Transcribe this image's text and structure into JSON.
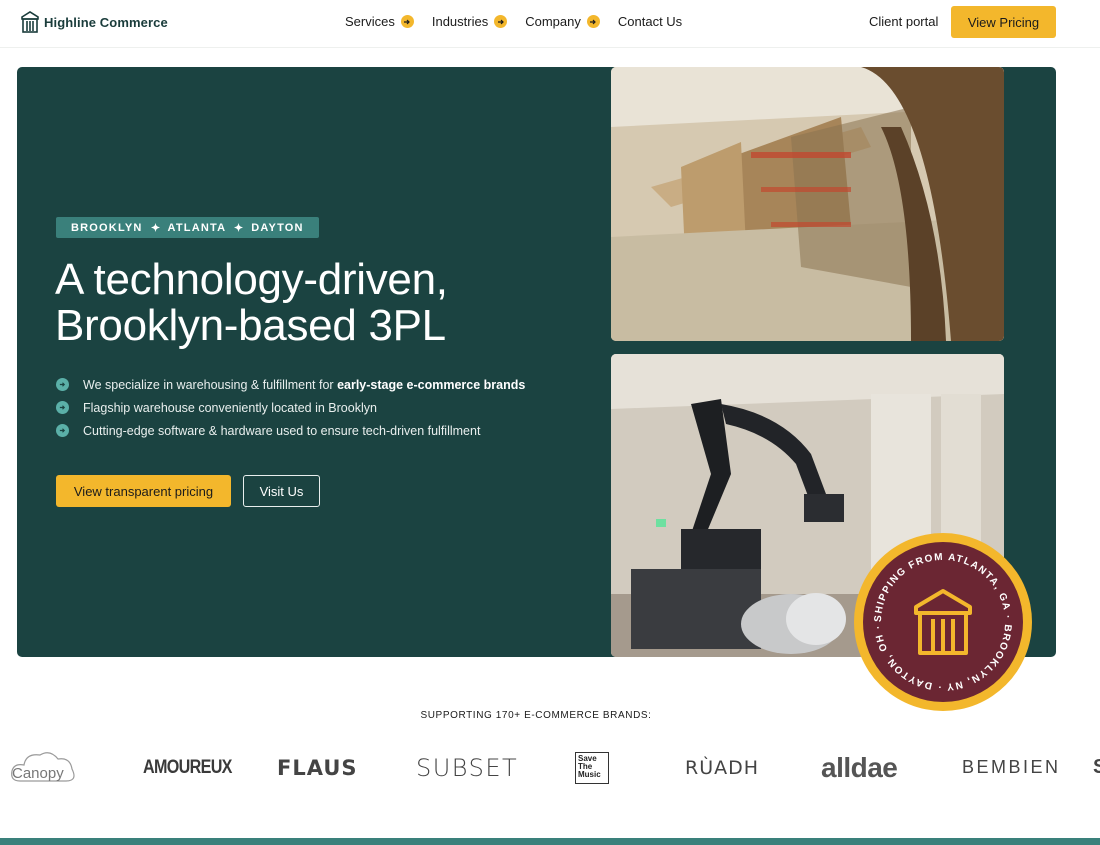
{
  "nav": {
    "logo_text": "Highline Commerce",
    "menu": [
      {
        "label": "Services",
        "has_arrow": true
      },
      {
        "label": "Industries",
        "has_arrow": true
      },
      {
        "label": "Company",
        "has_arrow": true
      },
      {
        "label": "Contact Us",
        "has_arrow": false
      }
    ],
    "client_portal": "Client portal",
    "cta": "View Pricing"
  },
  "hero": {
    "locations": [
      "BROOKLYN",
      "ATLANTA",
      "DAYTON"
    ],
    "headline_line1": "A technology-driven,",
    "headline_line2": "Brooklyn-based 3PL",
    "bullets": [
      {
        "text": "We specialize in warehousing & fulfillment for ",
        "bold": "early-stage e-commerce brands"
      },
      {
        "text": "Flagship warehouse conveniently located in Brooklyn",
        "bold": ""
      },
      {
        "text": "Cutting-edge software & hardware used to ensure tech-driven fulfillment",
        "bold": ""
      }
    ],
    "primary_button": "View transparent pricing",
    "secondary_button": "Visit Us",
    "badge_text": "SHIPPING FROM ATLANTA, GA · BROOKLYN, NY · DAYTON, OH ·"
  },
  "brands": {
    "heading": "SUPPORTING 170+ E-COMMERCE BRANDS:",
    "items": [
      "Canopy",
      "AMOUREUX",
      "FLAUS",
      "SUBSET",
      "Save The Music",
      "RÙADH",
      "alldae",
      "BEMBIEN",
      "S"
    ]
  },
  "colors": {
    "accent": "#f3b72c",
    "hero_bg": "#1b4341",
    "teal": "#3a807b",
    "badge_ring": "#f3b72c",
    "badge_center": "#6b2633"
  },
  "icons": [
    "logo-building-icon",
    "arrow-right-icon",
    "star-separator-icon",
    "bullet-arrow-icon"
  ]
}
